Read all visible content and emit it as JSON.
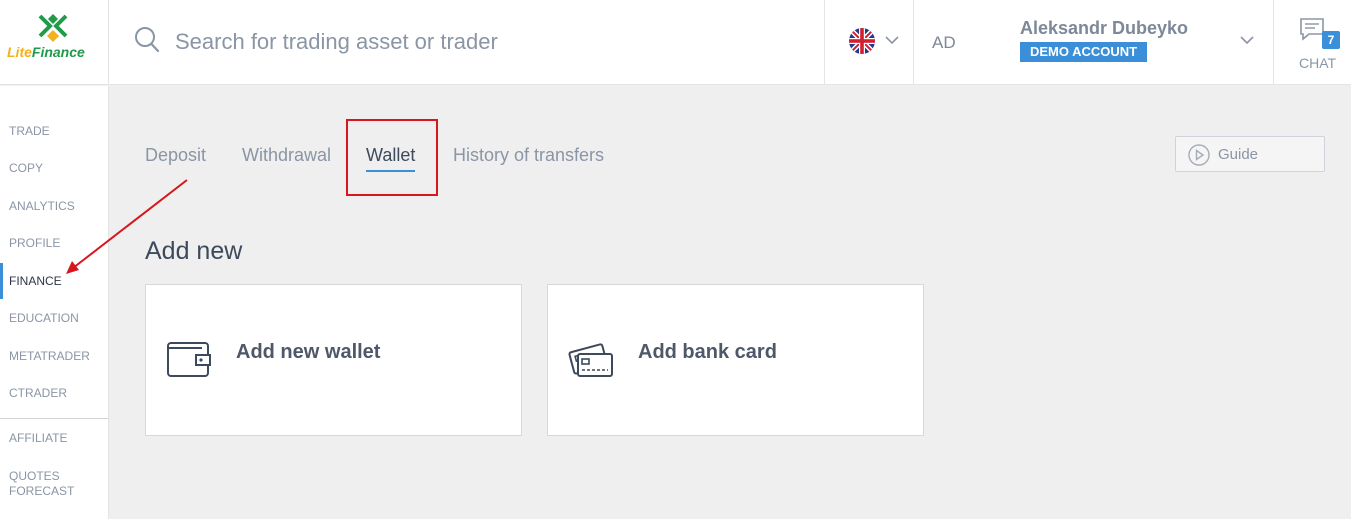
{
  "header": {
    "logo": {
      "text_part1": "Lite",
      "text_part2": "Finance",
      "icon": "litefinance-logo-icon"
    },
    "search": {
      "placeholder": "Search for trading asset or trader",
      "value": ""
    },
    "language": {
      "flag": "uk-flag-icon"
    },
    "user": {
      "initials": "AD",
      "name": "Aleksandr Dubeyko",
      "badge": "DEMO ACCOUNT"
    },
    "chat": {
      "label": "CHAT",
      "count": "7"
    }
  },
  "sidebar": {
    "items": [
      {
        "label": "TRADE"
      },
      {
        "label": "COPY"
      },
      {
        "label": "ANALYTICS"
      },
      {
        "label": "PROFILE"
      },
      {
        "label": "FINANCE",
        "active": true
      },
      {
        "label": "EDUCATION"
      },
      {
        "label": "METATRADER"
      },
      {
        "label": "CTRADER"
      }
    ],
    "secondary": [
      {
        "label": "AFFILIATE"
      },
      {
        "label": "QUOTES FORECAST"
      }
    ]
  },
  "tabs": [
    {
      "label": "Deposit"
    },
    {
      "label": "Withdrawal"
    },
    {
      "label": "Wallet",
      "active": true
    },
    {
      "label": "History of transfers"
    }
  ],
  "guide_button": {
    "label": "Guide"
  },
  "section": {
    "title": "Add new",
    "cards": [
      {
        "label": "Add new wallet",
        "icon": "wallet-icon"
      },
      {
        "label": "Add bank card",
        "icon": "bank-card-icon"
      }
    ]
  },
  "colors": {
    "accent": "#3a8fd8",
    "annotation": "#d8161c"
  }
}
